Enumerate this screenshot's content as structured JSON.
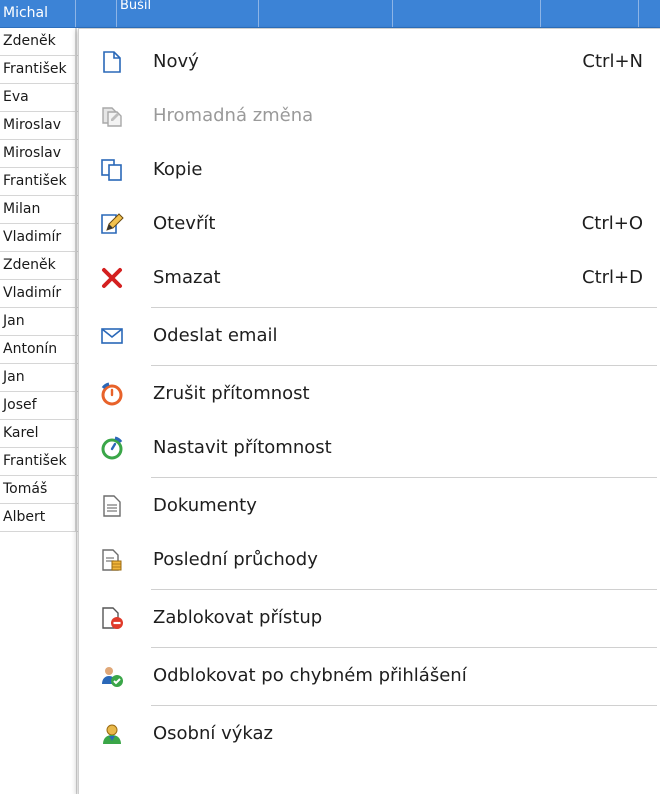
{
  "grid": {
    "rows": [
      {
        "first": "Michal",
        "second": "Bušil",
        "selected": true
      },
      {
        "first": "Zdeněk"
      },
      {
        "first": "František"
      },
      {
        "first": "Eva"
      },
      {
        "first": "Miroslav"
      },
      {
        "first": "Miroslav"
      },
      {
        "first": "František"
      },
      {
        "first": "Milan"
      },
      {
        "first": "Vladimír"
      },
      {
        "first": "Zdeněk"
      },
      {
        "first": "Vladimír"
      },
      {
        "first": "Jan"
      },
      {
        "first": "Antonín"
      },
      {
        "first": "Jan"
      },
      {
        "first": "Josef"
      },
      {
        "first": "Karel"
      },
      {
        "first": "František"
      },
      {
        "first": "Tomáš"
      },
      {
        "first": "Albert"
      }
    ]
  },
  "menu": {
    "items": [
      {
        "id": "new",
        "label": "Nový",
        "shortcut": "Ctrl+N",
        "icon": "new-document-icon"
      },
      {
        "id": "bulk-change",
        "label": "Hromadná změna",
        "shortcut": "",
        "icon": "bulk-change-icon",
        "disabled": true
      },
      {
        "id": "copy",
        "label": "Kopie",
        "shortcut": "",
        "icon": "copy-icon"
      },
      {
        "id": "open",
        "label": "Otevřít",
        "shortcut": "Ctrl+O",
        "icon": "edit-icon"
      },
      {
        "id": "delete",
        "label": "Smazat",
        "shortcut": "Ctrl+D",
        "icon": "delete-icon"
      },
      {
        "id": "send-email",
        "label": "Odeslat email",
        "shortcut": "",
        "icon": "email-icon",
        "sep_before": true
      },
      {
        "id": "cancel-attendance",
        "label": "Zrušit přítomnost",
        "shortcut": "",
        "icon": "cancel-attendance-icon",
        "sep_before": true
      },
      {
        "id": "set-attendance",
        "label": "Nastavit přítomnost",
        "shortcut": "",
        "icon": "set-attendance-icon"
      },
      {
        "id": "documents",
        "label": "Dokumenty",
        "shortcut": "",
        "icon": "document-icon",
        "sep_before": true
      },
      {
        "id": "last-passages",
        "label": "Poslední průchody",
        "shortcut": "",
        "icon": "passages-icon"
      },
      {
        "id": "block-access",
        "label": "Zablokovat přístup",
        "shortcut": "",
        "icon": "block-access-icon",
        "sep_before": true
      },
      {
        "id": "unblock-login",
        "label": "Odblokovat po chybném přihlášení",
        "shortcut": "",
        "icon": "unblock-user-icon",
        "sep_before": true
      },
      {
        "id": "personal-report",
        "label": "Osobní výkaz",
        "shortcut": "",
        "icon": "user-report-icon",
        "sep_before": true
      }
    ]
  },
  "colors": {
    "selection": "#3c83d6",
    "delete_red": "#d42020",
    "icon_blue": "#2a68b8"
  }
}
